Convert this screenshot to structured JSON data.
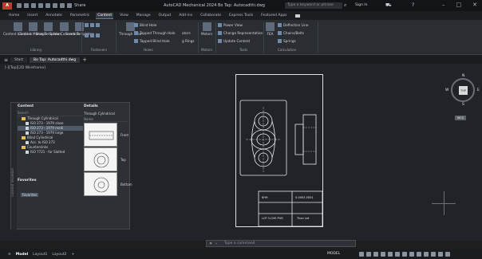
{
  "app": {
    "logo_text": "A",
    "title": "AutoCAD Mechanical 2024   Bo Tap: Autocadthi.dwg",
    "share": "Share",
    "search_placeholder": "Type a keyword or phrase",
    "sign_in": "Sign In"
  },
  "ribbon_tabs": [
    "Home",
    "Insert",
    "Annotate",
    "Parametric",
    "Content",
    "View",
    "Manage",
    "Output",
    "Add-ins",
    "Collaborate",
    "Express Tools",
    "Featured Apps"
  ],
  "active_tab": "Content",
  "ribbon": {
    "libraries": {
      "buttons": [
        "Content\nLibraries",
        "Content\nManager",
        "New\nTemplates",
        "Screw\nConnection",
        "Screw\nTemplates"
      ],
      "title": "Library"
    },
    "fasteners": {
      "rows": [
        "Blind Hole",
        "Tapped Through Hole",
        "Tapped Blind Hole"
      ],
      "through_hole": "Through\nHole",
      "title": "Fasteners",
      "washers": "ators",
      "rings": "g Rings"
    },
    "holes": {
      "title": "Holes"
    },
    "motors": {
      "label": "Motors",
      "title": "Motors"
    },
    "tools": {
      "rows": [
        "Power View",
        "Change Representation",
        "Update Content"
      ],
      "title": "Tools"
    },
    "calculation": {
      "rows": [
        "Deflection Line",
        "Chains/Belts",
        "Springs"
      ],
      "fea": "FEA",
      "title": "Calculation"
    }
  },
  "doc_tabs": [
    "Start",
    "Bo Tap: Autocadthi.dwg"
  ],
  "active_doc": "Bo Tap: Autocadthi.dwg",
  "viewport": {
    "label": "[-][Top][2D Wireframe]",
    "viewcube": {
      "face": "TOP",
      "n": "N",
      "s": "S",
      "w": "W",
      "e": "E"
    },
    "wcs": "WCS"
  },
  "drawing": {
    "title_block": {
      "row1_left": "LCP 3-CHS PUR",
      "row1_right": "Than Lat",
      "row2_left": "KHH",
      "row2_mid": "0-0003-0001"
    }
  },
  "content_palette": {
    "side_title": "CONTENT BROWSER",
    "content_header": "Content",
    "search_placeholder": "Search",
    "tree": [
      {
        "label": "Through Cylindrical",
        "type": "folder",
        "indent": 1
      },
      {
        "label": "ISO 273 - 1979 close",
        "type": "doc",
        "indent": 2
      },
      {
        "label": "ISO 273 - 1979 medi",
        "type": "doc",
        "indent": 2,
        "selected": true
      },
      {
        "label": "ISO 273 - 1979 large",
        "type": "doc",
        "indent": 2
      },
      {
        "label": "Blind Cylindrical",
        "type": "folder",
        "indent": 1
      },
      {
        "label": "Acc. to ISO 273",
        "type": "doc",
        "indent": 2
      },
      {
        "label": "Countersinks",
        "type": "folder",
        "indent": 1
      },
      {
        "label": "ISO 7721 - for Slotted",
        "type": "doc",
        "indent": 2
      }
    ],
    "details_header": "Details",
    "details_path": "Through Cylindrical",
    "details_name": "Name",
    "thumbnails": [
      "Front",
      "Top",
      "Bottom"
    ],
    "favorites_header": "Favorites",
    "favorites": [
      "Favorites"
    ]
  },
  "command_line": {
    "placeholder": "Type a command"
  },
  "layout_tabs": [
    "Model",
    "Layout1",
    "Layout2"
  ],
  "active_layout": "Model",
  "status": {
    "model": "MODEL"
  }
}
